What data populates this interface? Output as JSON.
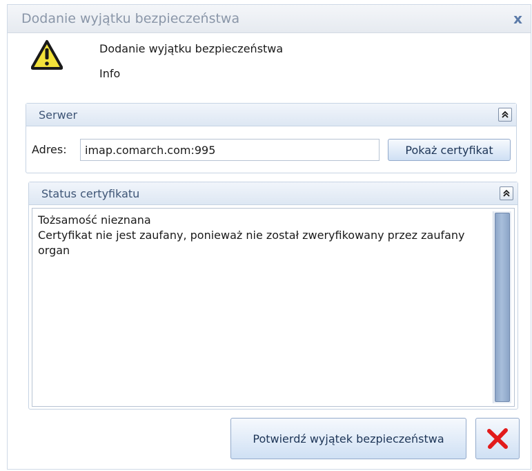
{
  "window": {
    "title": "Dodanie wyjątku bezpieczeństwa",
    "close_glyph": "x"
  },
  "header": {
    "title": "Dodanie wyjątku bezpieczeństwa",
    "subtitle": "Info",
    "icon": "warning-triangle-icon"
  },
  "server": {
    "title": "Serwer",
    "address_label": "Adres:",
    "address_value": "imap.comarch.com:995",
    "show_cert_label": "Pokaż certyfikat",
    "collapse_icon": "double-chevron-up-icon"
  },
  "status": {
    "title": "Status certyfikatu",
    "lines": [
      "Tożsamość nieznana",
      "Certyfikat nie jest zaufany, ponieważ nie został zweryfikowany przez zaufany organ"
    ],
    "collapse_icon": "double-chevron-up-icon"
  },
  "actions": {
    "confirm_label": "Potwierdź wyjątek bezpieczeństwa",
    "cancel_icon": "red-x-icon"
  },
  "colors": {
    "accent": "#5b7aa8",
    "cancel": "#e21b1b",
    "warning": "#f3e23a"
  }
}
